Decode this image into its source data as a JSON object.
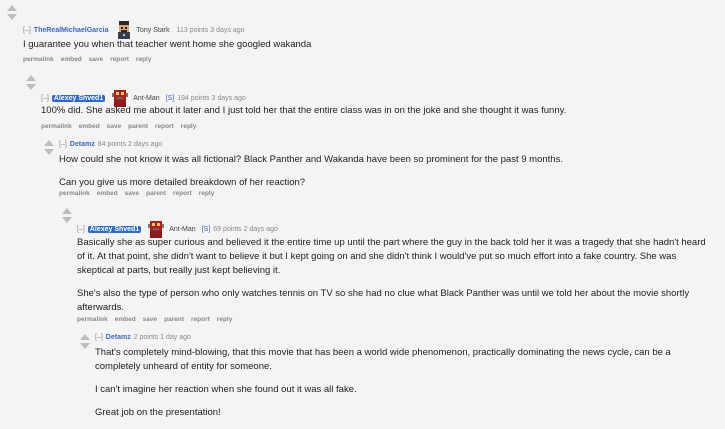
{
  "comments": [
    {
      "toggle": "[–]",
      "author": "TheRealMichaelGarcia",
      "flair": "Tony Stark",
      "meta": "113 points 3 days ago",
      "body": [
        "I guarantee you when that teacher went home she googled wakanda"
      ],
      "buttons": [
        "permalink",
        "embed",
        "save",
        "report",
        "reply"
      ]
    },
    {
      "toggle": "[–]",
      "author": "Alexey Shved1",
      "flair": "Ant-Man",
      "submitter": "[S]",
      "meta": "194 points 3 days ago",
      "body": [
        "100% did. She asked me about it later and I just told her that the entire class was in on the joke and she thought it was funny."
      ],
      "buttons": [
        "permalink",
        "embed",
        "save",
        "parent",
        "report",
        "reply"
      ]
    },
    {
      "toggle": "[–]",
      "author": "Detamz",
      "meta": "84 points 2 days ago",
      "body": [
        "How could she not know it was all fictional? Black Panther and Wakanda have been so prominent for the past 9 months.",
        "Can you give us more detailed breakdown of her reaction?"
      ],
      "buttons": [
        "permalink",
        "embed",
        "save",
        "parent",
        "report",
        "reply"
      ]
    },
    {
      "toggle": "[–]",
      "author": "Alexey Shved1",
      "flair": "Ant-Man",
      "submitter": "[S]",
      "meta": "69 points 2 days ago",
      "body": [
        "Basically she as super curious and believed it the entire time up until the part where the guy in the back told her it was a tragedy that she hadn't heard of it. At that point, she didn't want to believe it but I kept going on and she didn't think I would've put so much effort into a fake country. She was skeptical at parts, but really just kept believing it.",
        "She's also the type of person who only watches tennis on TV so she had no clue what Black Panther was until we told her about the movie shortly afterwards."
      ],
      "buttons": [
        "permalink",
        "embed",
        "save",
        "parent",
        "report",
        "reply"
      ]
    },
    {
      "toggle": "[–]",
      "author": "Detamz",
      "meta": "2 points 1 day ago",
      "body": [
        "That's completely mind-blowing, that this movie that has been a world wide phenomenon, practically dominating the news cycle, can be a completely unheard of entity for someone.",
        "I can't imagine her reaction when she found out it was all fake.",
        "Great job on the presentation!"
      ],
      "buttons": []
    }
  ],
  "flair_icons": {
    "tony_stark": "tony-stark-flair-icon",
    "ant_man": "ant-man-flair-icon"
  },
  "colors": {
    "author": "#3a68c4",
    "submitter_bg": "#2a6bd1",
    "background": "#f4f4f4"
  }
}
